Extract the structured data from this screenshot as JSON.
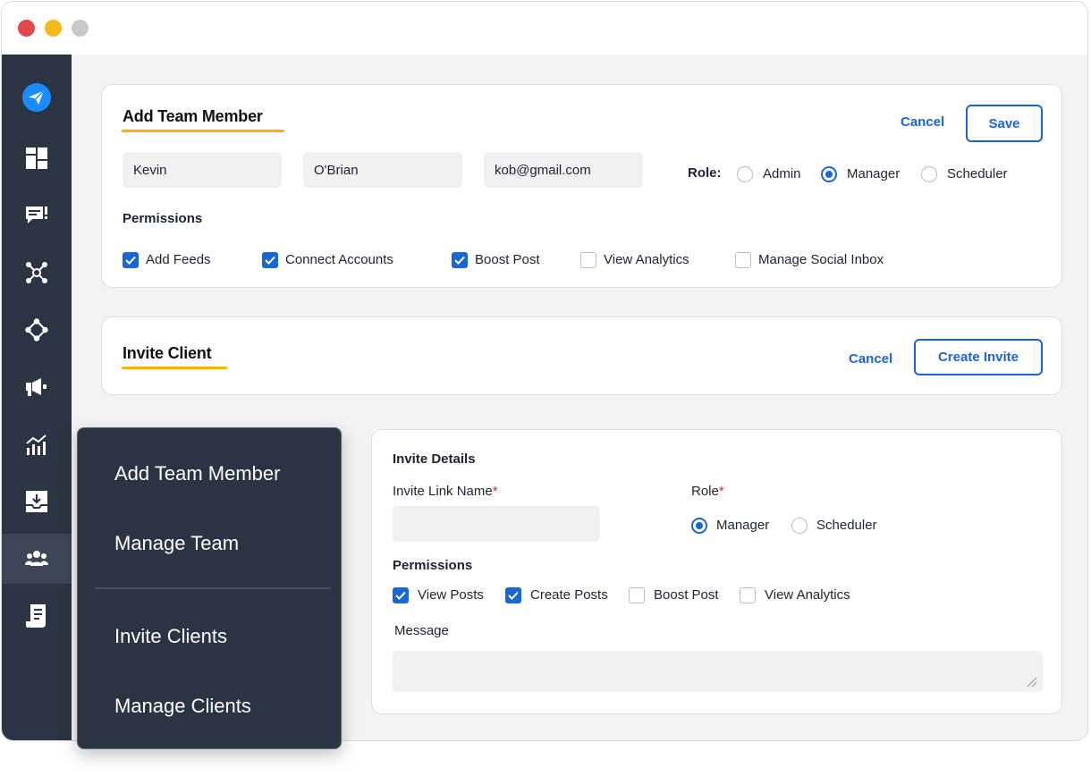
{
  "add_team_member": {
    "title": "Add Team Member",
    "cancel_label": "Cancel",
    "save_label": "Save",
    "first_name": "Kevin",
    "last_name": "O'Brian",
    "email": "kob@gmail.com",
    "role_label": "Role:",
    "roles": [
      {
        "label": "Admin",
        "selected": false
      },
      {
        "label": "Manager",
        "selected": true
      },
      {
        "label": "Scheduler",
        "selected": false
      }
    ],
    "permissions_label": "Permissions",
    "permissions": [
      {
        "label": "Add Feeds",
        "checked": true
      },
      {
        "label": "Connect Accounts",
        "checked": true
      },
      {
        "label": "Boost Post",
        "checked": true
      },
      {
        "label": "View Analytics",
        "checked": false
      },
      {
        "label": "Manage Social Inbox",
        "checked": false
      }
    ]
  },
  "invite_client": {
    "title": "Invite Client",
    "cancel_label": "Cancel",
    "create_label": "Create Invite"
  },
  "invite_details": {
    "title": "Invite Details",
    "link_name_label": "Invite Link Name",
    "required_mark": "*",
    "link_name_value": "",
    "role_label": "Role",
    "roles": [
      {
        "label": "Manager",
        "selected": true
      },
      {
        "label": "Scheduler",
        "selected": false
      }
    ],
    "permissions_label": "Permissions",
    "permissions": [
      {
        "label": "View Posts",
        "checked": true
      },
      {
        "label": "Create Posts",
        "checked": true
      },
      {
        "label": "Boost Post",
        "checked": false
      },
      {
        "label": "View Analytics",
        "checked": false
      }
    ],
    "message_label": "Message",
    "message_value": ""
  },
  "team_menu": {
    "items": [
      "Add Team Member",
      "Manage Team",
      "Invite Clients",
      "Manage Clients"
    ]
  },
  "sidebar": {
    "icons": [
      "send-icon",
      "dashboard-icon",
      "chat-icon",
      "network-icon",
      "share-icon",
      "megaphone-icon",
      "analytics-icon",
      "inbox-icon",
      "team-icon",
      "reports-icon"
    ],
    "active": "team-icon"
  },
  "colors": {
    "accent": "#1a66d4",
    "underline": "#f7b500",
    "sidebar": "#2b3442",
    "logo": "#1a8cff"
  }
}
